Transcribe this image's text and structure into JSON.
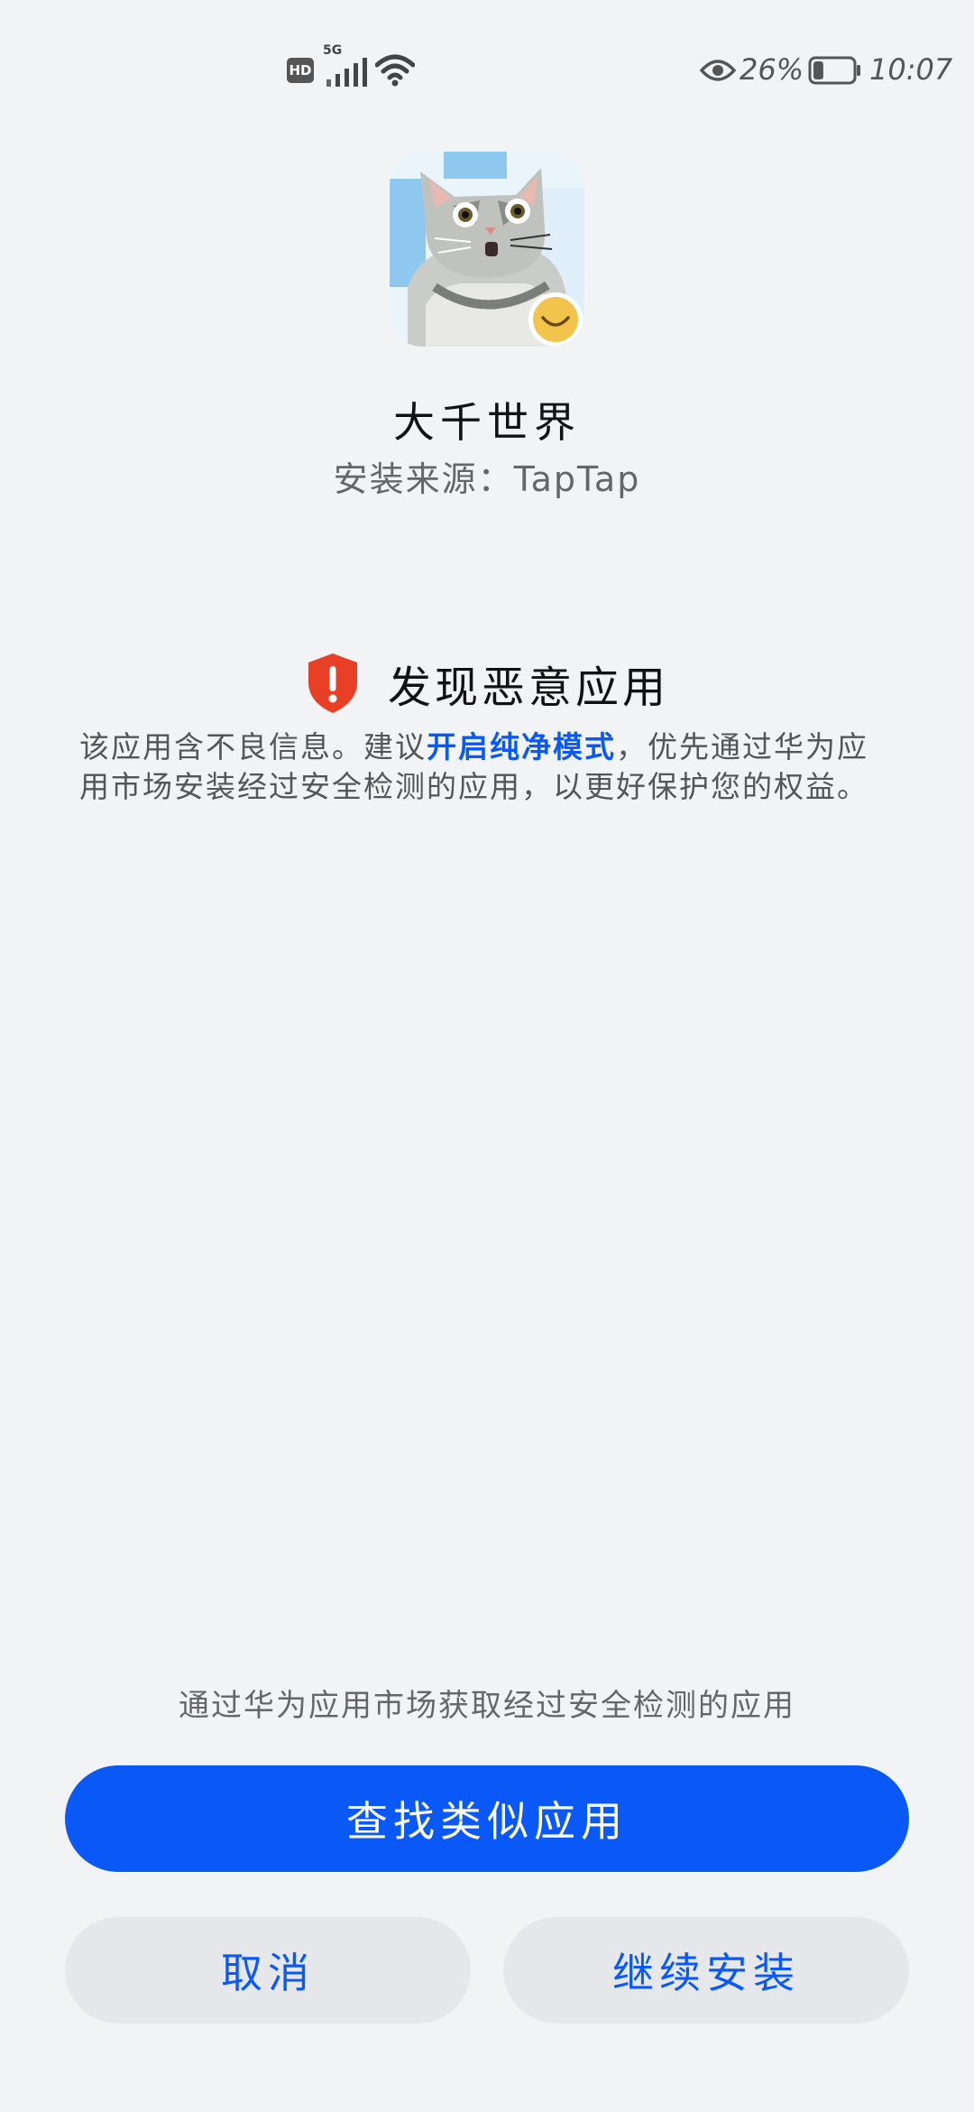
{
  "status_bar": {
    "hd_label": "HD",
    "network_label": "5G",
    "battery_percent": "26%",
    "time": "10:07",
    "battery_level": 0.26
  },
  "app": {
    "name": "大千世界",
    "install_source": "安装来源：TapTap",
    "icon": "pixel-cat-icon"
  },
  "warning": {
    "icon": "shield-alert-icon",
    "title": "发现恶意应用",
    "desc_before": "该应用含不良信息。建议",
    "desc_link": "开启纯净模式",
    "desc_after": "，优先通过华为应用市场安装经过安全检测的应用，以更好保护您的权益。"
  },
  "footer": {
    "hint": "通过华为应用市场获取经过安全检测的应用",
    "find_similar_label": "查找类似应用",
    "cancel_label": "取消",
    "continue_label": "继续安装"
  },
  "colors": {
    "accent": "#0a59f7",
    "danger": "#e84026",
    "background": "#f1f3f5"
  }
}
